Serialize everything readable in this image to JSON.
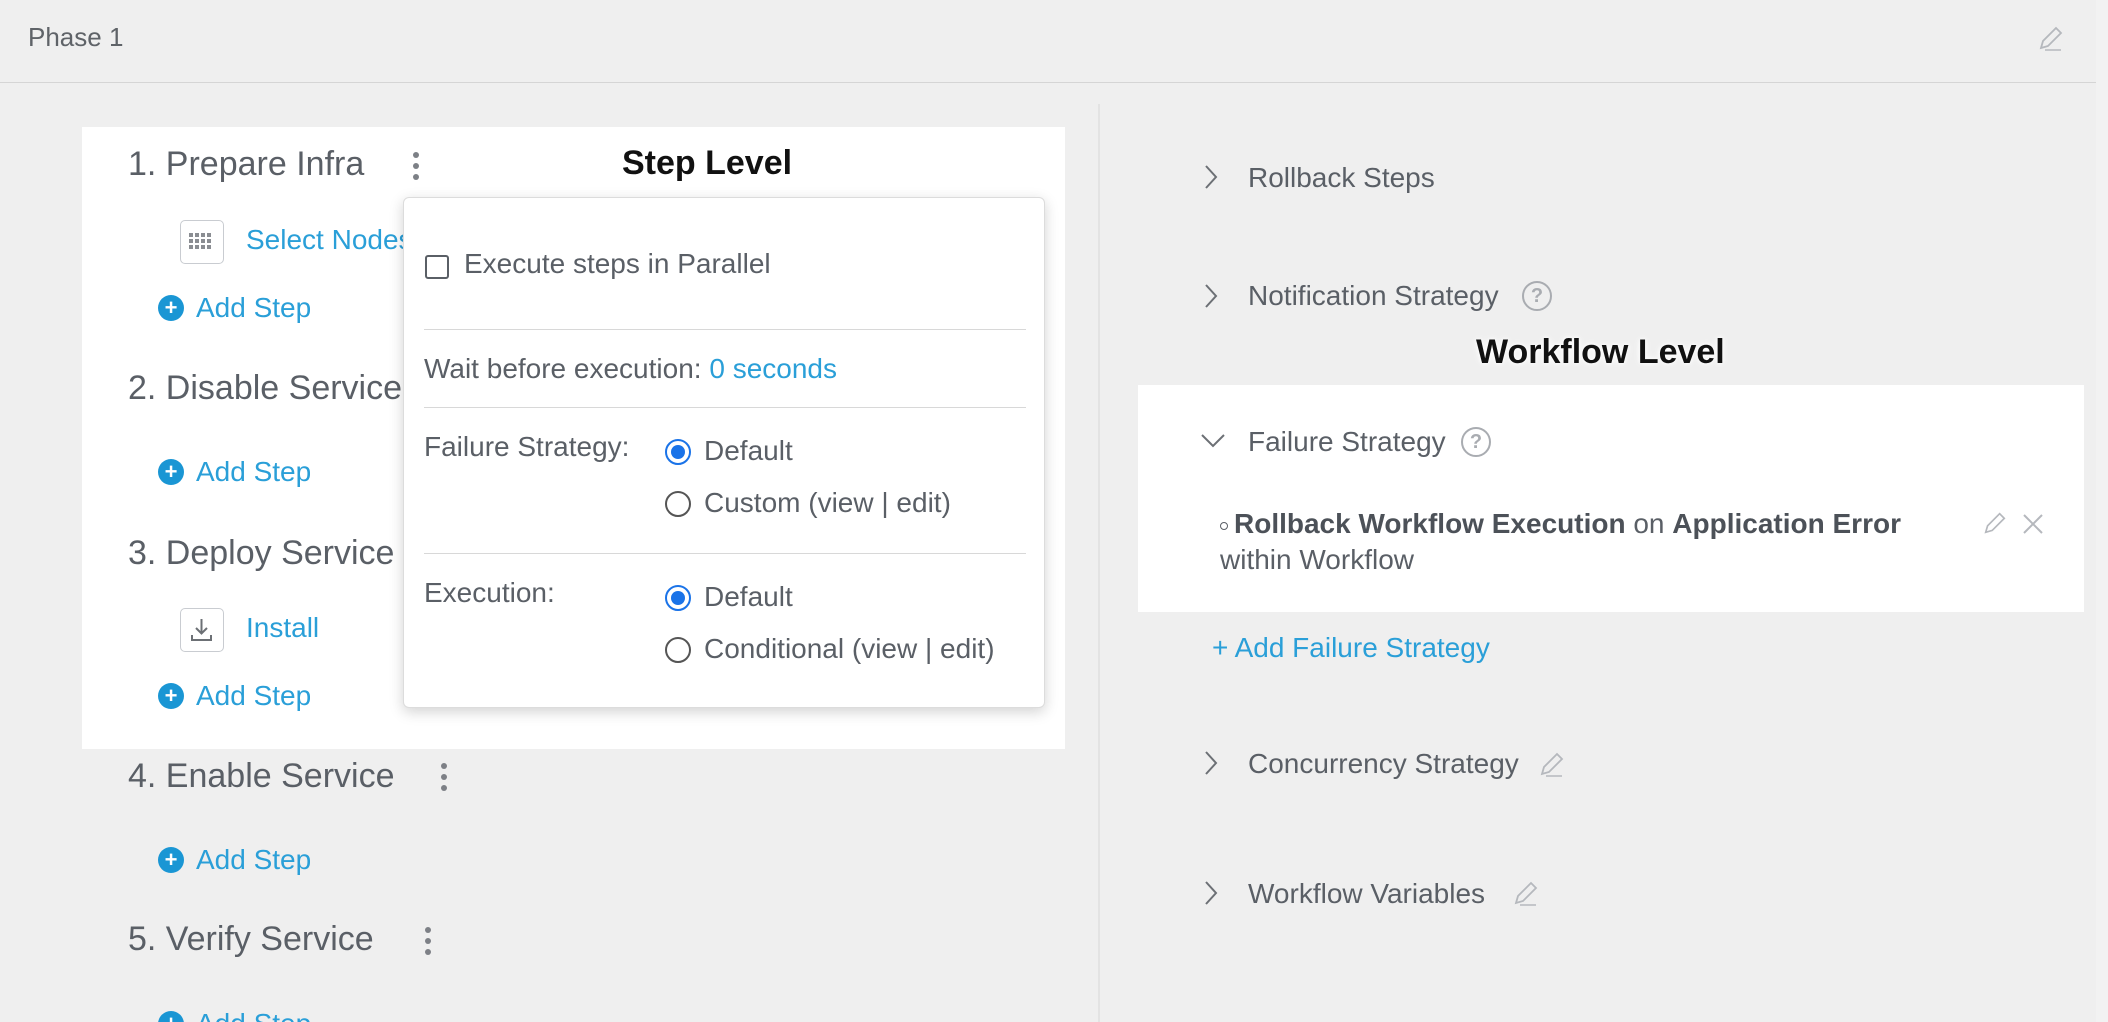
{
  "header": {
    "title": "Phase 1"
  },
  "sections": [
    {
      "title": "1. Prepare Infra",
      "steps": [
        {
          "label": "Select Nodes",
          "icon": "grid-icon"
        }
      ],
      "add_label": "Add Step"
    },
    {
      "title": "2. Disable Service",
      "steps": [],
      "add_label": "Add Step"
    },
    {
      "title": "3. Deploy Service",
      "steps": [
        {
          "label": "Install",
          "icon": "download-icon"
        }
      ],
      "add_label": "Add Step"
    },
    {
      "title": "4. Enable Service",
      "steps": [],
      "add_label": "Add Step"
    },
    {
      "title": "5. Verify Service",
      "steps": [],
      "add_label": "Add Step"
    }
  ],
  "annotations": {
    "step_level": "Step Level",
    "workflow_level": "Workflow Level"
  },
  "popup": {
    "parallel_label": "Execute steps in Parallel",
    "parallel_checked": false,
    "wait_label": "Wait before execution:",
    "wait_value": "0 seconds",
    "failure_label": "Failure Strategy:",
    "failure_options": [
      "Default",
      "Custom (view | edit)"
    ],
    "failure_selected": "Default",
    "execution_label": "Execution:",
    "execution_options": [
      "Default",
      "Conditional (view | edit)"
    ],
    "execution_selected": "Default"
  },
  "workflow": {
    "rollback": "Rollback Steps",
    "notification": "Notification Strategy",
    "failure": {
      "title": "Failure Strategy",
      "rule": {
        "action": "Rollback Workflow Execution",
        "on": "on",
        "condition": "Application Error",
        "within": "within",
        "scope": "Workflow"
      },
      "add_label": "+ Add Failure Strategy"
    },
    "concurrency": "Concurrency Strategy",
    "variables": "Workflow Variables"
  },
  "colors": {
    "link": "#2a9fd8",
    "accent": "#1a96d4",
    "radio": "#1a73e8",
    "background": "#efefef"
  }
}
